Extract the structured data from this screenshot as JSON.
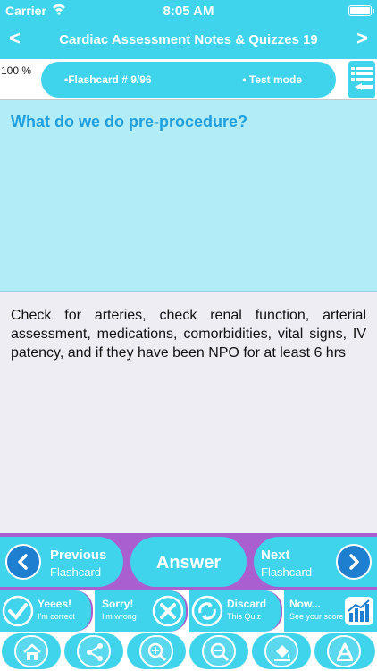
{
  "status_bar": {
    "carrier": "Carrier",
    "time": "8:05 AM"
  },
  "nav_bar": {
    "title": "Cardiac Assessment Notes & Quizzes 19",
    "back": "<",
    "forward": ">"
  },
  "info": {
    "progress": "100 %",
    "flashcard": "•Flashcard #  9/96",
    "mode": "• Test mode"
  },
  "question": "What do we do pre-procedure?",
  "answer": "Check for arteries, check renal function, arterial assessment, medications, comorbidities, vital signs, IV patency, and if they have been NPO for at least 6 hrs",
  "nav_buttons": {
    "previous_big": "Previous",
    "previous_small": "Flashcard",
    "answer": "Answer",
    "next_big": "Next",
    "next_small": "Flashcard"
  },
  "actions": [
    {
      "label": "Yeees!",
      "sub": "I'm correct",
      "icon": "checkmark-icon"
    },
    {
      "label": "Sorry!",
      "sub": "I'm wrong",
      "icon": "cross-icon"
    },
    {
      "label": "Discard",
      "sub": "This Quiz",
      "icon": "recycle-icon"
    },
    {
      "label": "Now...",
      "sub": "See your score",
      "icon": "bar-chart-icon"
    }
  ],
  "toolbar": [
    "home-icon",
    "share-icon",
    "zoom-in-icon",
    "zoom-out-icon",
    "paint-bucket-icon",
    "font-icon"
  ],
  "colors": {
    "primary": "#3fd4ec",
    "accent": "#a95fd0",
    "question_text": "#1f9fde",
    "answer_bg": "#ededf3"
  }
}
